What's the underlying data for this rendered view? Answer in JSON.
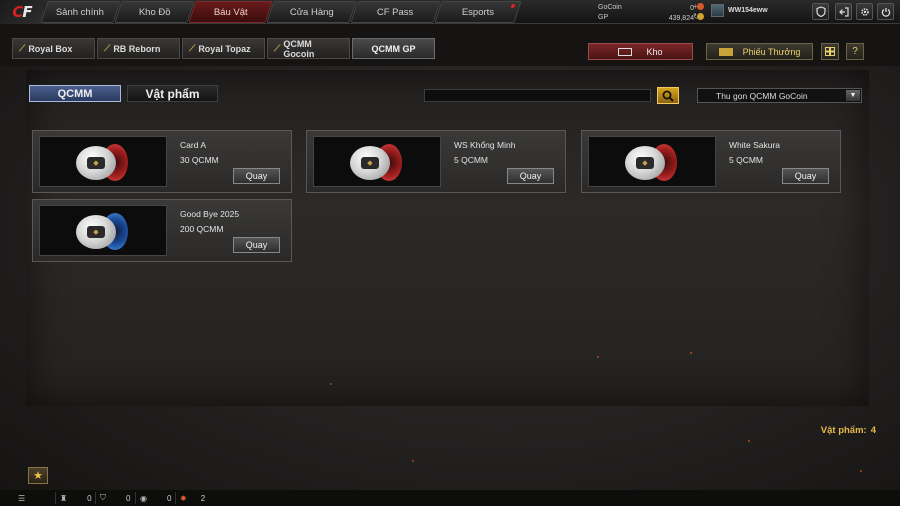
{
  "logo": {
    "text_a": "C",
    "text_b": "F"
  },
  "nav": [
    {
      "label": "Sảnh chính",
      "active": false
    },
    {
      "label": "Kho Đồ",
      "active": false
    },
    {
      "label": "Báu Vật",
      "active": true
    },
    {
      "label": "Cửa Hàng",
      "active": false
    },
    {
      "label": "CF Pass",
      "active": false
    },
    {
      "label": "Esports",
      "active": false,
      "dot": true
    }
  ],
  "wallet": {
    "gocoin_label": "GoCoin",
    "gocoin_value": "0",
    "gp_label": "GP",
    "gp_value": "439,824"
  },
  "side_icons": {
    "add": "+",
    "refresh": "↻"
  },
  "user": {
    "name": "WW154eww"
  },
  "top_icons": [
    "shield-icon",
    "exit-icon",
    "settings-icon",
    "power-icon"
  ],
  "subtabs": [
    {
      "label": "Royal Box",
      "icon": "bow-icon",
      "active": false
    },
    {
      "label": "RB Reborn",
      "icon": "bow-icon",
      "active": false
    },
    {
      "label": "Royal Topaz",
      "icon": "bow-icon",
      "active": false
    },
    {
      "label": "QCMM Gocoin",
      "icon": "bow-icon",
      "active": false
    },
    {
      "label": "QCMM GP",
      "icon": "",
      "active": true
    }
  ],
  "actions": {
    "kho_label": "Kho",
    "voucher_label": "Phiếu Thưởng"
  },
  "categories": {
    "active": "QCMM",
    "inactive": "Vật phẩm"
  },
  "search": {
    "value": "",
    "placeholder": ""
  },
  "filter": {
    "selected": "Thu gọn QCMM GoCoin"
  },
  "items": [
    {
      "name": "Card A",
      "price": "30 QCMM",
      "button": "Quay",
      "capsule": "red"
    },
    {
      "name": "WS Khổng Minh",
      "price": "5 QCMM",
      "button": "Quay",
      "capsule": "red"
    },
    {
      "name": "White Sakura",
      "price": "5 QCMM",
      "button": "Quay",
      "capsule": "red"
    },
    {
      "name": "Good Bye 2025",
      "price": "200 QCMM",
      "button": "Quay",
      "capsule": "blue"
    }
  ],
  "item_count": {
    "label": "Vật phẩm:",
    "value": "4"
  },
  "bottom": {
    "a": "0",
    "b": "0",
    "c": "0",
    "d": "2"
  },
  "colors": {
    "accent_gold": "#e6b84a",
    "active_tab_blue": "#4b5f8e",
    "nav_active_red": "#6a1a1a"
  }
}
